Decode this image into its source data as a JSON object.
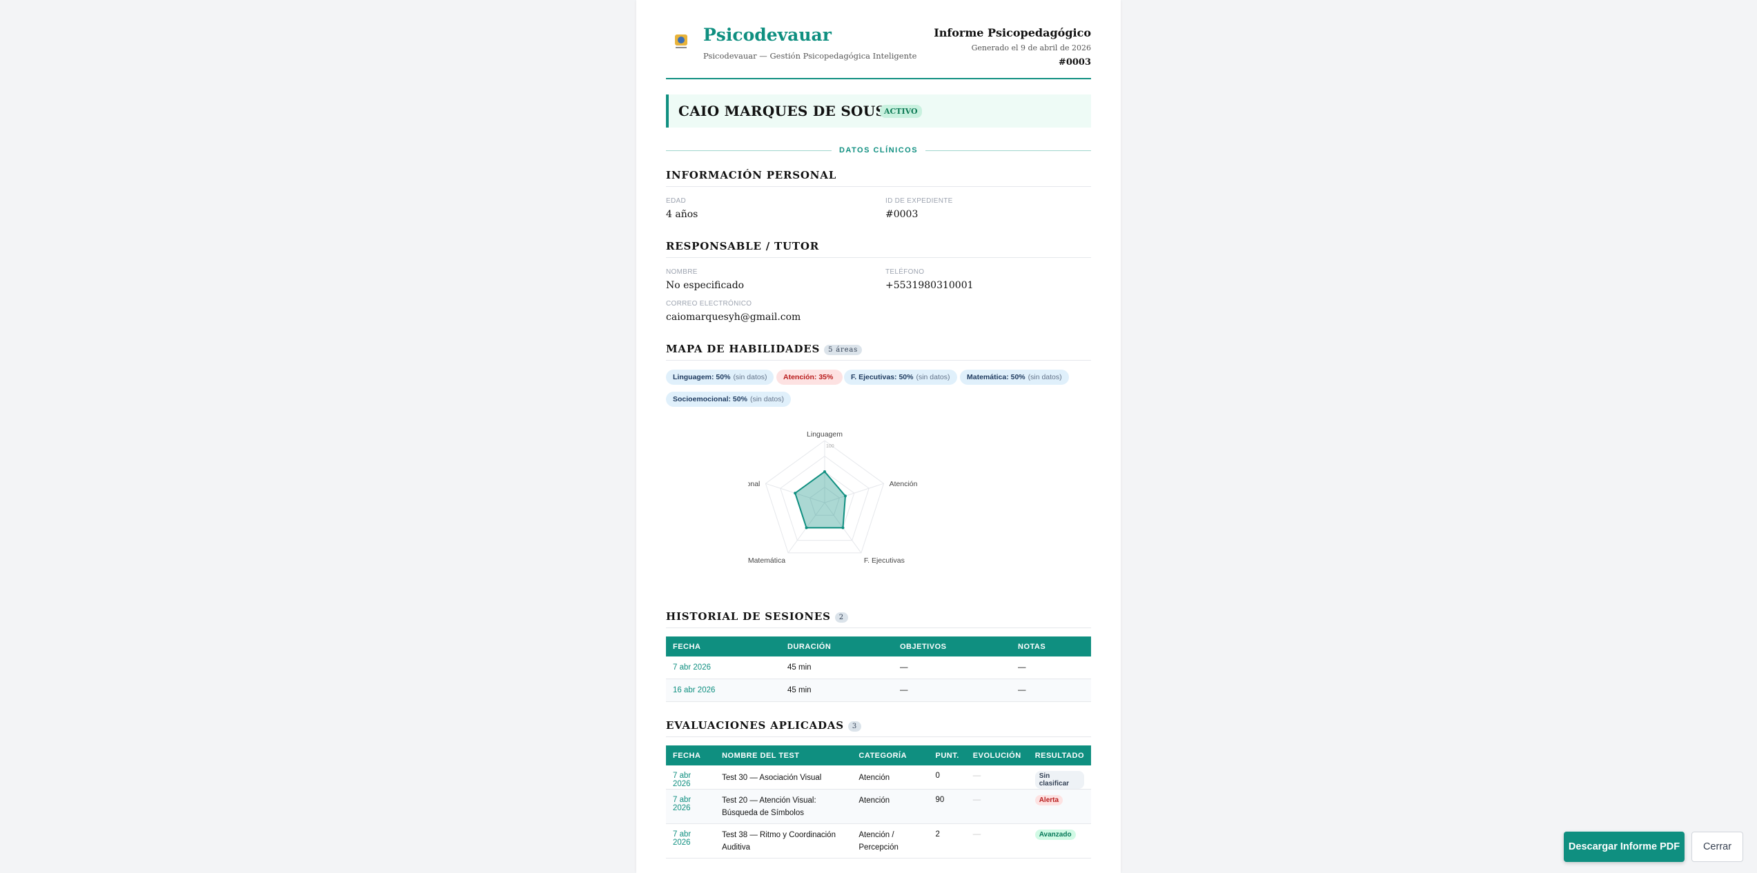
{
  "header": {
    "brand": "Psicodevauar",
    "brand_sub": "Psicodevauar — Gestión Psicopedagógica Inteligente",
    "report_title": "Informe Psicopedagógico",
    "generated": "Generado el 9 de abril de 2026",
    "report_id": "#0003",
    "logo_icon": "logo-icon"
  },
  "patient": {
    "name": "CAIO MARQUES DE SOUSA",
    "status": "ACTIVO"
  },
  "divider_label": "DATOS CLÍNICOS",
  "personal": {
    "title": "INFORMACIÓN PERSONAL",
    "age_label": "EDAD",
    "age": "4 años",
    "file_label": "ID DE EXPEDIENTE",
    "file": "#0003"
  },
  "guardian": {
    "title": "RESPONSABLE / TUTOR",
    "name_label": "NOMBRE",
    "name": "No especificado",
    "phone_label": "TELÉFONO",
    "phone": "+5531980310001",
    "email_label": "CORREO ELECTRÓNICO",
    "email": "caiomarquesyh@gmail.com"
  },
  "skills": {
    "title": "MAPA DE HABILIDADES",
    "count": "5 áreas",
    "chips": [
      {
        "label": "Linguagem: 50%",
        "note": "(sin datos)",
        "color": "blue"
      },
      {
        "label": "Atención: 35%",
        "note": "",
        "color": "red"
      },
      {
        "label": "F. Ejecutivas: 50%",
        "note": "(sin datos)",
        "color": "blue"
      },
      {
        "label": "Matemática: 50%",
        "note": "(sin datos)",
        "color": "blue"
      },
      {
        "label": "Socioemocional: 50%",
        "note": "(sin datos)",
        "color": "blue"
      }
    ]
  },
  "chart_data": {
    "type": "radar",
    "categories": [
      "Linguagem",
      "Atención",
      "F. Ejecutivas",
      "Matemática",
      "Socioemocional"
    ],
    "values": [
      50,
      35,
      50,
      50,
      50
    ],
    "max": 100,
    "tick_labels": [
      "100"
    ],
    "fill_color": "#0f8f80"
  },
  "sessions": {
    "title": "HISTORIAL DE SESIONES",
    "count": "2",
    "columns": [
      "FECHA",
      "DURACIÓN",
      "OBJETIVOS",
      "NOTAS"
    ],
    "rows": [
      [
        "7 abr 2026",
        "45 min",
        "—",
        "—"
      ],
      [
        "16 abr 2026",
        "45 min",
        "—",
        "—"
      ]
    ]
  },
  "evaluations": {
    "title": "EVALUACIONES APLICADAS",
    "count": "3",
    "columns": [
      "FECHA",
      "NOMBRE DEL TEST",
      "CATEGORÍA",
      "PUNT.",
      "EVOLUCIÓN",
      "RESULTADO"
    ],
    "rows": [
      {
        "date": "7 abr 2026",
        "name": "Test 30 — Asociación Visual",
        "category": "Atención",
        "score": "0",
        "evo": "—",
        "result": "Sin clasificar",
        "result_type": "sc"
      },
      {
        "date": "7 abr 2026",
        "name": "Test 20 — Atención Visual: Búsqueda de Símbolos",
        "category": "Atención",
        "score": "90",
        "evo": "—",
        "result": "Alerta",
        "result_type": "al"
      },
      {
        "date": "7 abr 2026",
        "name": "Test 38 — Ritmo y Coordinación Auditiva",
        "category": "Atención / Percepción",
        "score": "2",
        "evo": "—",
        "result": "Avanzado",
        "result_type": "av"
      }
    ]
  },
  "actions": {
    "download": "Descargar Informe PDF",
    "close": "Cerrar"
  }
}
